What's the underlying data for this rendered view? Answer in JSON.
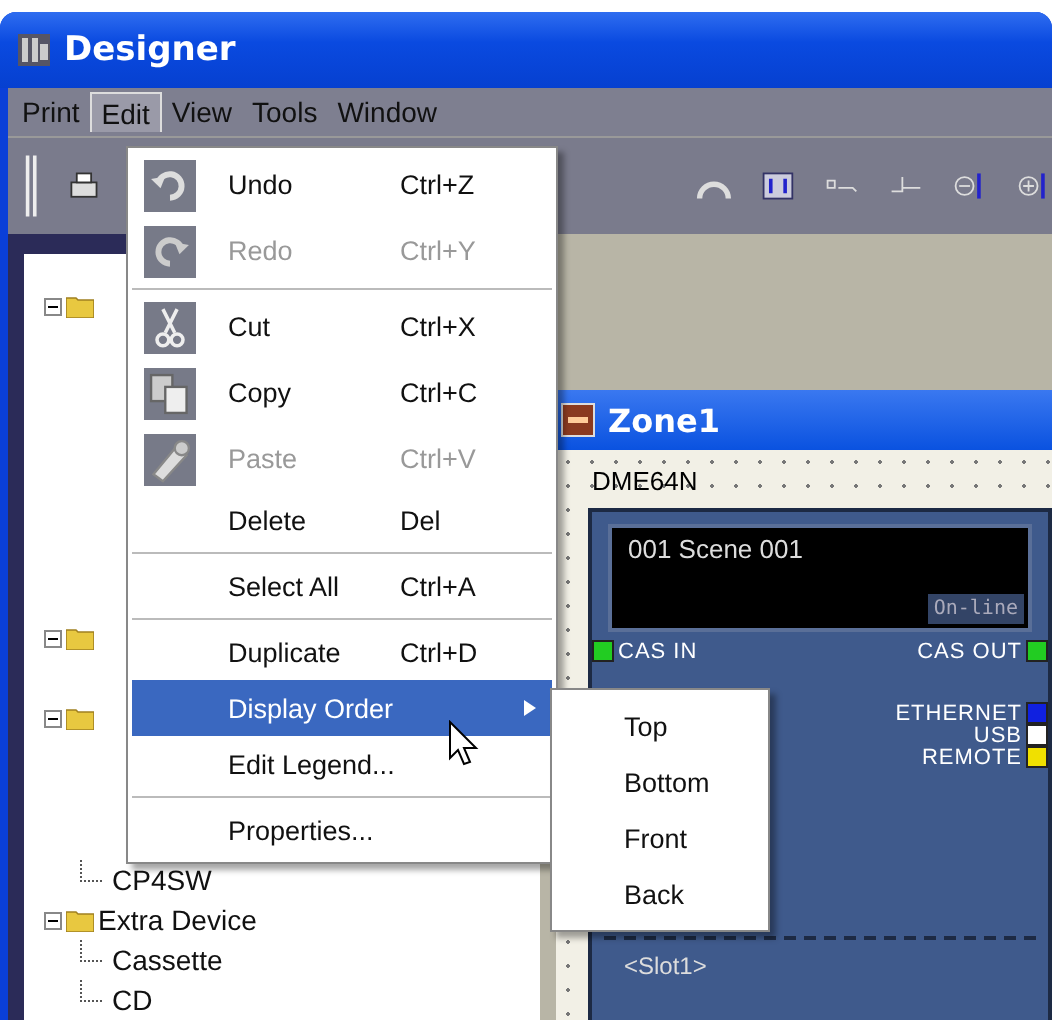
{
  "window": {
    "title": "Designer"
  },
  "menubar": [
    {
      "label": "Print",
      "selected": false
    },
    {
      "label": "Edit",
      "selected": true
    },
    {
      "label": "View",
      "selected": false
    },
    {
      "label": "Tools",
      "selected": false
    },
    {
      "label": "Window",
      "selected": false
    }
  ],
  "edit_menu": {
    "groups": [
      [
        {
          "label": "Undo",
          "shortcut": "Ctrl+Z",
          "disabled": false,
          "selected": false
        },
        {
          "label": "Redo",
          "shortcut": "Ctrl+Y",
          "disabled": true,
          "selected": false
        }
      ],
      [
        {
          "label": "Cut",
          "shortcut": "Ctrl+X",
          "disabled": false,
          "selected": false
        },
        {
          "label": "Copy",
          "shortcut": "Ctrl+C",
          "disabled": false,
          "selected": false
        },
        {
          "label": "Paste",
          "shortcut": "Ctrl+V",
          "disabled": true,
          "selected": false
        },
        {
          "label": "Delete",
          "shortcut": "Del",
          "disabled": false,
          "selected": false
        }
      ],
      [
        {
          "label": "Select All",
          "shortcut": "Ctrl+A",
          "disabled": false,
          "selected": false
        }
      ],
      [
        {
          "label": "Duplicate",
          "shortcut": "Ctrl+D",
          "disabled": false,
          "selected": false
        },
        {
          "label": "Display Order",
          "submenu": true,
          "disabled": false,
          "selected": true
        },
        {
          "label": "Edit Legend...",
          "disabled": false,
          "selected": false
        }
      ],
      [
        {
          "label": "Properties...",
          "disabled": false,
          "selected": false
        }
      ]
    ]
  },
  "submenu": [
    "Top",
    "Bottom",
    "Front",
    "Back"
  ],
  "tree": {
    "top": [
      {
        "expanded": true
      },
      {
        "expanded": true
      },
      {
        "expanded": true
      }
    ],
    "items": [
      {
        "label": "CP4SW"
      },
      {
        "label": "Extra Device",
        "expanded": true,
        "children": [
          {
            "label": "Cassette"
          },
          {
            "label": "CD"
          }
        ]
      }
    ]
  },
  "zone_window": {
    "title": "Zone1"
  },
  "device": {
    "name": "DME64N",
    "scene": "001 Scene 001",
    "status": "On-line",
    "ports_left": [
      {
        "label": "CAS IN",
        "color": "#22cc22"
      }
    ],
    "ports_right": [
      {
        "label": "CAS OUT",
        "color": "#22cc22"
      },
      {
        "label": "ETHERNET",
        "color": "#1020e0"
      },
      {
        "label": "USB",
        "color": "#ffffff"
      },
      {
        "label": "REMOTE",
        "color": "#f0e000"
      }
    ],
    "slot": "<Slot1>"
  }
}
